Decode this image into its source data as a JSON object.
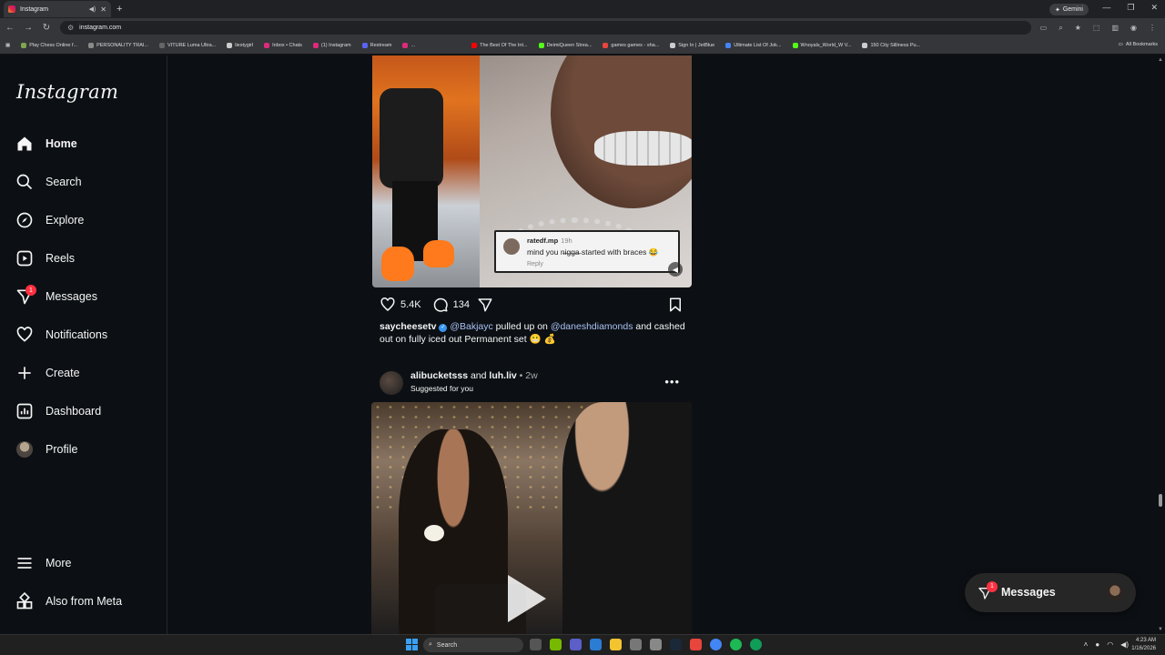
{
  "browser": {
    "tab_title": "Instagram",
    "new_tab": "+",
    "gemini_label": "Gemini",
    "url": "instagram.com",
    "bookmarks": [
      {
        "label": "Play Chess Online f...",
        "color": "#7fa650"
      },
      {
        "label": "PERSONALITY TRAI...",
        "color": "#8a8a8a"
      },
      {
        "label": "VITURE Luma Ultra...",
        "color": "#222222"
      },
      {
        "label": "liestygirl",
        "color": "#cccccc"
      },
      {
        "label": "Inbox • Chats",
        "color": "#dd2a7b"
      },
      {
        "label": "(1) Instagram",
        "color": "#dd2a7b"
      },
      {
        "label": "Restream",
        "color": "#5865f2"
      },
      {
        "label": "...",
        "color": "#dd2a7b"
      },
      {
        "label": "The Best Of The Int...",
        "color": "#ff0000"
      },
      {
        "label": "DeimiQueen Strea...",
        "color": "#53fc18"
      },
      {
        "label": "games games - sha...",
        "color": "#e8453c"
      },
      {
        "label": "Sign In | JetBlue",
        "color": "#cccccc"
      },
      {
        "label": "Ultimate List Of Jok...",
        "color": "#4285f4"
      },
      {
        "label": "Wnoyals_World_W V...",
        "color": "#53fc18"
      },
      {
        "label": "150 City Silliness Pu...",
        "color": "#cccccc"
      }
    ],
    "all_bookmarks": "All Bookmarks"
  },
  "sidebar": {
    "logo": "Instagram",
    "items": [
      {
        "label": "Home",
        "icon": "home-icon"
      },
      {
        "label": "Search",
        "icon": "search-icon"
      },
      {
        "label": "Explore",
        "icon": "compass-icon"
      },
      {
        "label": "Reels",
        "icon": "reels-icon"
      },
      {
        "label": "Messages",
        "icon": "messenger-icon",
        "badge": "1"
      },
      {
        "label": "Notifications",
        "icon": "heart-icon"
      },
      {
        "label": "Create",
        "icon": "plus-icon"
      },
      {
        "label": "Dashboard",
        "icon": "dashboard-icon"
      },
      {
        "label": "Profile",
        "icon": "avatar"
      }
    ],
    "more": "More",
    "also_from_meta": "Also from Meta"
  },
  "post1": {
    "comment_card": {
      "user": "ratedf.mp",
      "time": "19h",
      "text": "mind you n̶i̶g̶g̶a̶ started with braces 😂",
      "reply": "Reply"
    },
    "likes": "5.4K",
    "comments": "134",
    "caption": {
      "user": "saycheesetv",
      "mention1": "@Bakjayc",
      "text1": " pulled up on ",
      "mention2": "@daneshdiamonds",
      "text2": " and cashed out on fully iced out Permanent set 😬 💰"
    }
  },
  "post2": {
    "user1": "alibucketsss",
    "and": " and ",
    "user2": "luh.liv",
    "time": " • 2w",
    "subtitle": "Suggested for you",
    "more": "•••"
  },
  "messages_pill": {
    "label": "Messages",
    "badge": "1"
  },
  "taskbar": {
    "search": "Search",
    "time": "4:23 AM",
    "date": "1/16/2026"
  }
}
